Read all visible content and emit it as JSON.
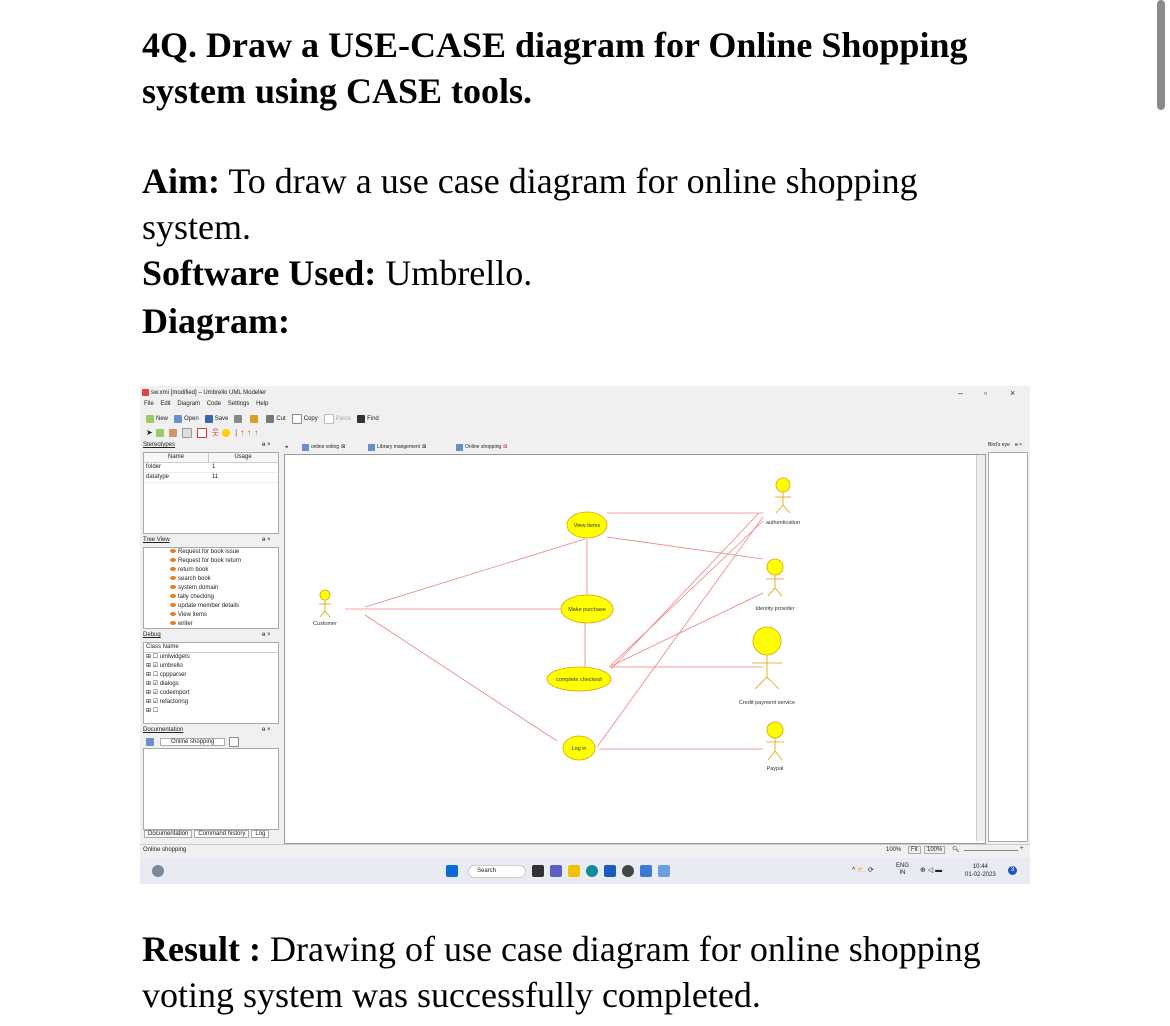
{
  "doc": {
    "title": "4Q. Draw a USE-CASE diagram for Online Shopping system using CASE tools.",
    "aim_label": "Aim:",
    "aim_text": " To draw a use case diagram for online shopping system.",
    "software_label": "Software Used:",
    "software_text": " Umbrello.",
    "diagram_label": "Diagram:",
    "result_label": "Result :",
    "result_text": " Drawing of use case diagram for online shopping voting system was successfully completed."
  },
  "app": {
    "window_title": "sw.xmi [modified] – Umbrello UML Modeller",
    "menu": [
      "File",
      "Edit",
      "Diagram",
      "Code",
      "Settings",
      "Help"
    ],
    "toolbar": {
      "new": "New",
      "open": "Open",
      "save": "Save",
      "cut": "Cut",
      "copy": "Copy",
      "paste": "Paste",
      "find": "Find"
    },
    "stereotypes": {
      "header": "Stereotypes",
      "col_name": "Name",
      "col_usage": "Usage",
      "rows": [
        [
          "folder",
          "1"
        ],
        [
          "datatype",
          "11"
        ]
      ]
    },
    "tree_view": {
      "header": "Tree View",
      "items": [
        "Request for book issue",
        "Request for book return",
        "return book",
        "search book",
        "system domain",
        "tally checking",
        "update member details",
        "View items",
        "writer"
      ]
    },
    "debug": {
      "header": "Debug",
      "col": "Class Name",
      "items": [
        "umlwidgets",
        "umbrello",
        "cppparser",
        "dialogs",
        "codeimport",
        "refactoring",
        ""
      ],
      "checked": [
        false,
        true,
        false,
        true,
        true,
        true,
        false
      ]
    },
    "documentation": {
      "header": "Documentation",
      "value": "Online shopping",
      "tabs": [
        "Documentation",
        "Command history",
        "Log"
      ]
    },
    "tabs": [
      "online voting",
      "Library mangement",
      "Online shopping"
    ],
    "birds_eye": "Bird's eye",
    "status": {
      "left": "Online shopping",
      "zoom": "100%",
      "fit": "Fit",
      "zoom2": "100%"
    },
    "taskbar": {
      "search": "Search",
      "lang1": "ENG",
      "lang2": "IN",
      "time": "10:44",
      "date": "01-02-2023",
      "badge": "3"
    }
  },
  "uml": {
    "use_cases": [
      "View items",
      "Make purchase",
      "complete checkout",
      "Log in"
    ],
    "actors": [
      "Customer",
      "authentication",
      "Identity provider",
      "Credit payment service",
      "Paypal"
    ],
    "colors": {
      "usecase_fill": "#ffff00",
      "usecase_stroke": "#e0a000",
      "line": "#f08080",
      "actor": "#e0a000"
    }
  }
}
